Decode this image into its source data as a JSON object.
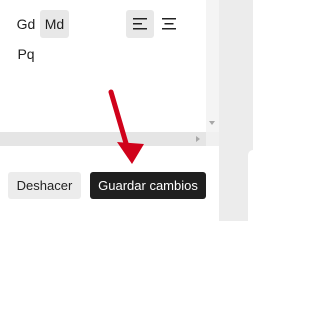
{
  "font_sizes": {
    "large": "Gd",
    "medium": "Md",
    "small": "Pq",
    "selected": "Md"
  },
  "alignment": {
    "options": [
      "align-left-icon",
      "align-center-icon"
    ],
    "selected": "align-left-icon"
  },
  "actions": {
    "undo_label": "Deshacer",
    "save_label": "Guardar cambios"
  },
  "colors": {
    "annotation_arrow": "#d0021b",
    "primary_button": "#1f1f1f",
    "secondary_button": "#ececec",
    "selected_bg": "#e8e8e8"
  }
}
